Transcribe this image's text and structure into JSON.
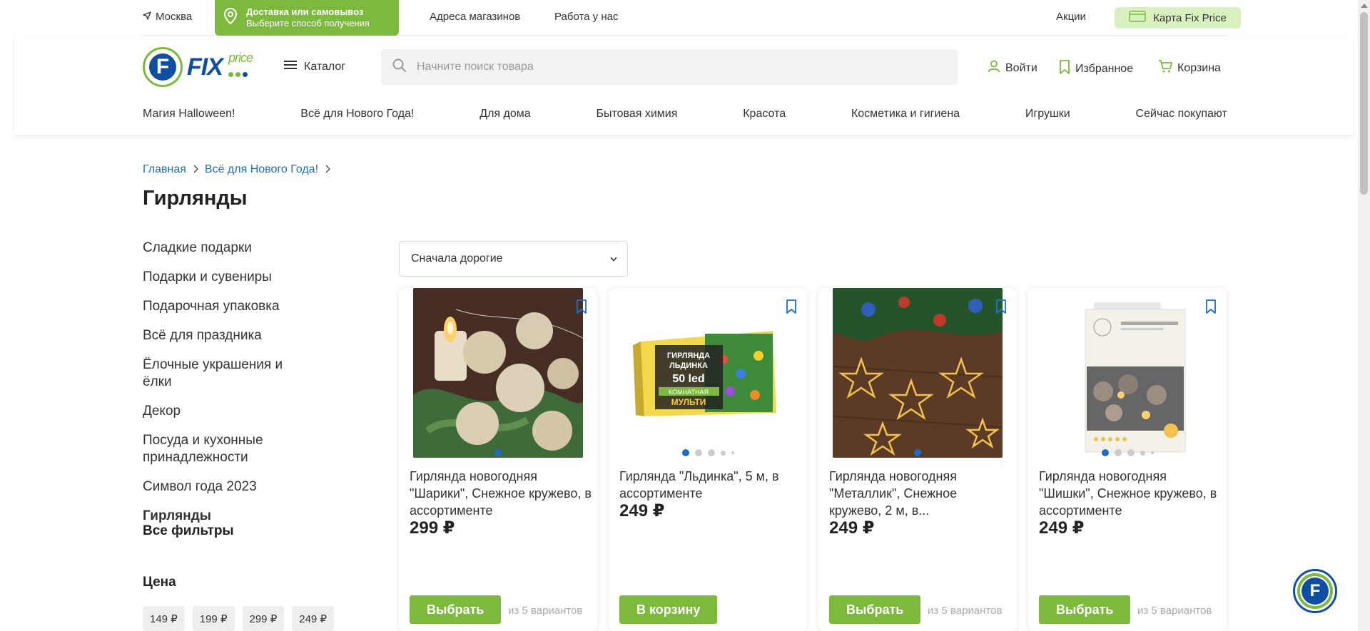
{
  "topbar": {
    "city": "Москва",
    "delivery_title": "Доставка или самовывоз",
    "delivery_subtitle": "Выберите способ получения",
    "stores": "Адреса магазинов",
    "jobs": "Работа у нас",
    "promo": "Акции",
    "fixcard": "Карта Fix Price"
  },
  "header": {
    "logo_text": "FIX",
    "logo_price": "price",
    "catalog": "Каталог",
    "search_placeholder": "Начните поиск товара",
    "login": "Войти",
    "favorites": "Избранное",
    "cart": "Корзина"
  },
  "nav": [
    "Магия Halloween!",
    "Всё для Нового Года!",
    "Для дома",
    "Бытовая химия",
    "Красота",
    "Косметика и гигиена",
    "Игрушки",
    "Сейчас покупают"
  ],
  "breadcrumbs": [
    "Главная",
    "Всё для Нового Года!"
  ],
  "page_title": "Гирлянды",
  "sidebar": {
    "items": [
      "Сладкие подарки",
      "Подарки и сувениры",
      "Подарочная упаковка",
      "Всё для праздника",
      "Ёлочные украшения и ёлки",
      "Декор",
      "Посуда и кухонные принадлежности",
      "Символ года 2023",
      "Гирлянды"
    ],
    "active": "Гирлянды",
    "all_filters": "Все фильтры",
    "price_heading": "Цена",
    "price_chips": [
      "149 ₽",
      "199 ₽",
      "299 ₽",
      "249 ₽"
    ]
  },
  "sort": {
    "selected": "Сначала дорогие"
  },
  "products": [
    {
      "name": "Гирлянда новогодняя \"Шарики\", Снежное кружево, в ассортименте",
      "price": "299 ₽",
      "button": "Выбрать",
      "variants": "из 5 вариантов"
    },
    {
      "name": "Гирлянда \"Льдинка\", 5 м, в ассортименте",
      "price": "249 ₽",
      "button": "В корзину",
      "variants": ""
    },
    {
      "name": "Гирлянда новогодняя \"Металлик\", Снежное кружево, 2 м, в...",
      "price": "249 ₽",
      "button": "Выбрать",
      "variants": "из 5 вариантов"
    },
    {
      "name": "Гирлянда новогодняя \"Шишки\", Снежное кружево, в ассортименте",
      "price": "249 ₽",
      "button": "Выбрать",
      "variants": "из 5 вариантов"
    }
  ],
  "product_box": {
    "line1": "ГИРЛЯНДА",
    "line2": "ЛЬДИНКА",
    "line3": "50 led",
    "line4": "КОМНАТНАЯ",
    "line5": "МУЛЬТИ"
  },
  "colors": {
    "accent": "#7cb93c",
    "brand_blue": "#0f4ea3",
    "link": "#1c6fc9"
  }
}
